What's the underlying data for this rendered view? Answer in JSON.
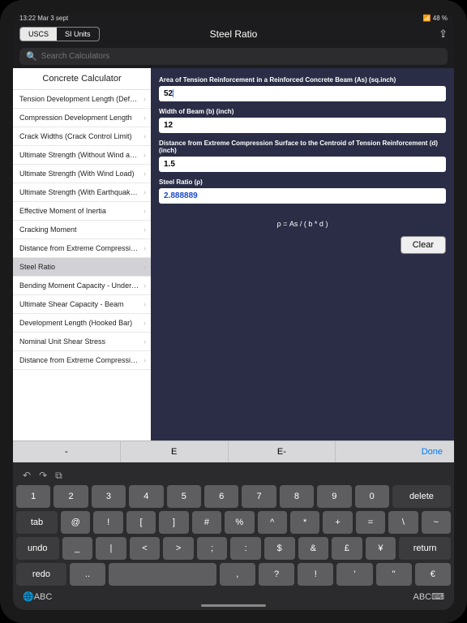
{
  "status": {
    "time": "13:22   Mar 3 sept",
    "battery": "48 %"
  },
  "segments": {
    "uscs": "USCS",
    "si": "SI Units"
  },
  "header": {
    "title": "Steel Ratio"
  },
  "search": {
    "placeholder": "Search Calculators"
  },
  "sidebar": {
    "title": "Concrete Calculator",
    "items": [
      "Tension Development Length (Defor...",
      "Compression Development Length",
      "Crack Widths (Crack Control Limit)",
      "Ultimate Strength (Without Wind and...",
      "Ultimate Strength (With Wind Load)",
      "Ultimate Strength (With Earthquake L...",
      "Effective Moment of Inertia",
      "Cracking Moment",
      "Distance from Extreme Compression...",
      "Steel Ratio",
      "Bending Moment Capacity - Underrei...",
      "Ultimate Shear Capacity - Beam",
      "Development Length (Hooked Bar)",
      "Nominal Unit Shear Stress",
      "Distance from Extreme Compression..."
    ],
    "selected": 9
  },
  "fields": {
    "as_label": "Area of Tension Reinforcement in a Reinforced Concrete Beam (As) (sq.inch)",
    "as_value": "52",
    "b_label": "Width of Beam (b) (inch)",
    "b_value": "12",
    "d_label": "Distance from Extreme Compression Surface to the Centroid of Tension Reinforcement (d) (inch)",
    "d_value": "1.5",
    "rho_label": "Steel Ratio (ρ)",
    "rho_value": "2.888889"
  },
  "formula": "ρ = As / ( b * d )",
  "clear": "Clear",
  "accessory": {
    "dash": "-",
    "e": "E",
    "eminus": "E-",
    "done": "Done"
  },
  "keyboard": {
    "top": {
      "undo_icon": "↶",
      "redo_icon": "↷",
      "paste_icon": "⧉"
    },
    "row1": [
      "1",
      "2",
      "3",
      "4",
      "5",
      "6",
      "7",
      "8",
      "9",
      "0",
      "delete"
    ],
    "row2_left": "tab",
    "row2": [
      "@",
      "!",
      "[",
      "]",
      "#",
      "%",
      "^",
      "*",
      "+",
      "=",
      "\\",
      "~"
    ],
    "row3_left": "undo",
    "row3": [
      "_",
      "|",
      "<",
      ">",
      ";",
      ":",
      "$",
      "&",
      "£",
      "¥",
      "return"
    ],
    "row4_left": "redo",
    "row4": [
      "..",
      ",",
      "?",
      "!",
      "'",
      "\"",
      "€"
    ],
    "bottom": {
      "globe": "🌐",
      "abc1": "ABC",
      "abc2": "ABC",
      "kb": "⌨"
    }
  }
}
